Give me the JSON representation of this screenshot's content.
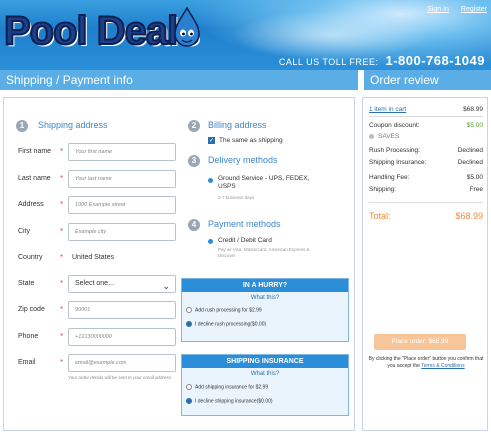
{
  "header": {
    "logo_text": "Pool Deals",
    "sign_in": "Sign In",
    "register": "Register",
    "toll_free_label": "CALL US TOLL FREE:",
    "toll_free_number": "1-800-768-1049"
  },
  "sections": {
    "left_title": "Shipping / Payment info",
    "right_title": "Order review"
  },
  "shipping": {
    "step": "1",
    "title": "Shipping address",
    "fields": {
      "first_name": {
        "label": "First name",
        "placeholder": "Your first name"
      },
      "last_name": {
        "label": "Last name",
        "placeholder": "Your last name"
      },
      "address": {
        "label": "Address",
        "placeholder": "1000 Example street"
      },
      "city": {
        "label": "City",
        "placeholder": "Example city"
      },
      "country": {
        "label": "Country",
        "value": "United States"
      },
      "state": {
        "label": "State",
        "value": "Select one..."
      },
      "zip": {
        "label": "Zip code",
        "placeholder": "90001"
      },
      "phone": {
        "label": "Phone",
        "placeholder": "+12130000000"
      },
      "email": {
        "label": "Email",
        "placeholder": "email@example.com"
      }
    },
    "email_hint": "Your order details will be sent to your email address.",
    "required_mark": "*"
  },
  "billing": {
    "step": "2",
    "title": "Billing address",
    "same_as_shipping": "The same as shipping"
  },
  "delivery": {
    "step": "3",
    "title": "Delivery methods",
    "option_label": "Ground Service - UPS, FEDEX, USPS",
    "option_note": "2-7 business days"
  },
  "payment": {
    "step": "4",
    "title": "Payment methods",
    "option_label": "Credit / Debit Card",
    "option_note": "Pay w/ Visa, Mastercard, American Express & Discover"
  },
  "hurry": {
    "title": "IN A HURRY?",
    "whats_this": "What this?",
    "option_add": "Add rush processing for $2.99",
    "option_decline": "I decline rush processing($0.00)"
  },
  "insurance": {
    "title": "SHIPPING INSURANCE",
    "whats_this": "What this?",
    "option_add": "Add shipping insurance for $2.99",
    "option_decline": "I decline shipping insurance($0.00)"
  },
  "review": {
    "items_link": "1 item in cart",
    "items_amount": "$68.99",
    "coupon_label": "Coupon discount:",
    "coupon_amount": "$5.00",
    "saves_label": "SAVES",
    "rows": [
      {
        "label": "Rush Processing:",
        "value": "Declined"
      },
      {
        "label": "Shipping Insurance:",
        "value": "Declined"
      },
      {
        "label": "Handling Fee:",
        "value": "$5.00"
      },
      {
        "label": "Shipping:",
        "value": "Free"
      }
    ],
    "total_label": "Total:",
    "total_amount": "$68.99",
    "place_order": "Place order: $68.99",
    "disclaimer_pre": "By clicking the \"Place order\" button you confirm that you accept the",
    "terms_link": "Terms & Conditions"
  }
}
